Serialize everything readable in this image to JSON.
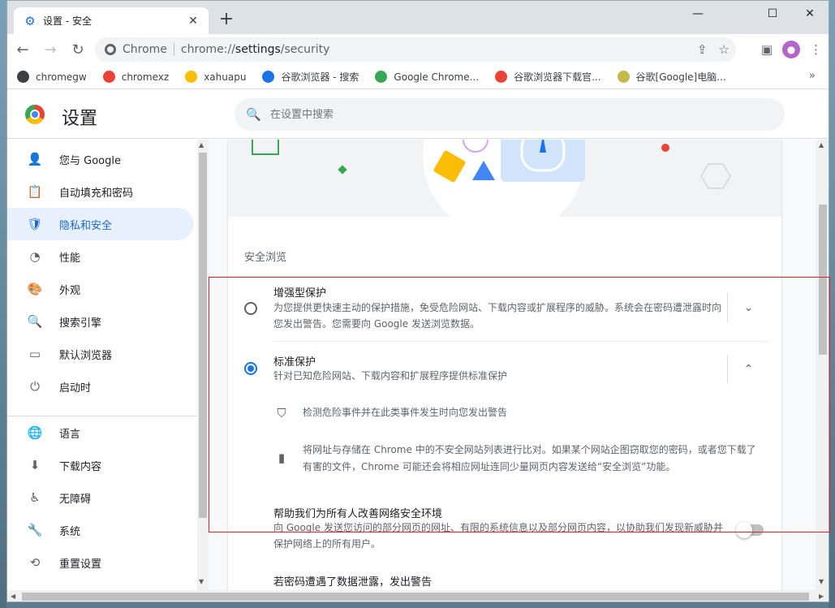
{
  "tab": {
    "title": "设置 - 安全",
    "close": "✕",
    "new_tab": "+"
  },
  "window_controls": {
    "minimize": "—",
    "maximize": "☐",
    "close": "✕"
  },
  "toolbar": {
    "back": "←",
    "forward": "→",
    "reload": "↻",
    "site_label": "Chrome",
    "url_scheme": "chrome://",
    "url_host": "settings",
    "url_path": "/security"
  },
  "bookmarks": [
    {
      "label": "chromegw",
      "color": "#3c4043"
    },
    {
      "label": "chromexz",
      "color": "#ea4335"
    },
    {
      "label": "xahuapu",
      "color": "#fbbc04"
    },
    {
      "label": "谷歌浏览器 - 搜索",
      "color": "#1a73e8"
    },
    {
      "label": "Google Chrome...",
      "color": "#34a853"
    },
    {
      "label": "谷歌浏览器下载官...",
      "color": "#ea4335"
    },
    {
      "label": "谷歌[Google]电脑...",
      "color": "#c5b94a"
    }
  ],
  "bookmarks_more": "»",
  "header": {
    "title": "设置",
    "search_placeholder": "在设置中搜索"
  },
  "sidebar": {
    "items": [
      {
        "label": "您与 Google",
        "icon": "👤"
      },
      {
        "label": "自动填充和密码",
        "icon": "📋"
      },
      {
        "label": "隐私和安全",
        "icon": "🛡"
      },
      {
        "label": "性能",
        "icon": "◔"
      },
      {
        "label": "外观",
        "icon": "🎨"
      },
      {
        "label": "搜索引擎",
        "icon": "🔍"
      },
      {
        "label": "默认浏览器",
        "icon": "▭"
      },
      {
        "label": "启动时",
        "icon": "⏻"
      },
      {
        "label": "语言",
        "icon": "🌐"
      },
      {
        "label": "下载内容",
        "icon": "⬇"
      },
      {
        "label": "无障碍",
        "icon": "♿"
      },
      {
        "label": "系统",
        "icon": "🔧"
      },
      {
        "label": "重置设置",
        "icon": "⟲"
      }
    ]
  },
  "main": {
    "section_title": "安全浏览",
    "enhanced": {
      "title": "增强型保护",
      "desc": "为您提供更快速主动的保护措施，免受危险网站、下载内容或扩展程序的威胁。系统会在密码遭泄露时向您发出警告。您需要向 Google 发送浏览数据。",
      "expand": "⌄"
    },
    "standard": {
      "title": "标准保护",
      "desc": "针对已知危险网站、下载内容和扩展程序提供标准保护",
      "expand": "⌃"
    },
    "detail1": "检测危险事件并在此类事件发生时向您发出警告",
    "detail2": "将网址与存储在 Chrome 中的不安全网站列表进行比对。如果某个网站企图窃取您的密码，或者您下载了有害的文件，Chrome 可能还会将相应网址连同少量网页内容发送给“安全浏览”功能。",
    "help": {
      "title": "帮助我们为所有人改善网络安全环境",
      "desc": "向 Google 发送您访问的部分网页的网址、有限的系统信息以及部分网页内容，以协助我们发现新威胁并保护网络上的所有用户。"
    },
    "password_warning": "若密码遭遇了数据泄露，发出警告"
  },
  "colors": {
    "accent": "#1a73e8",
    "highlight_box": "#e0202a"
  }
}
